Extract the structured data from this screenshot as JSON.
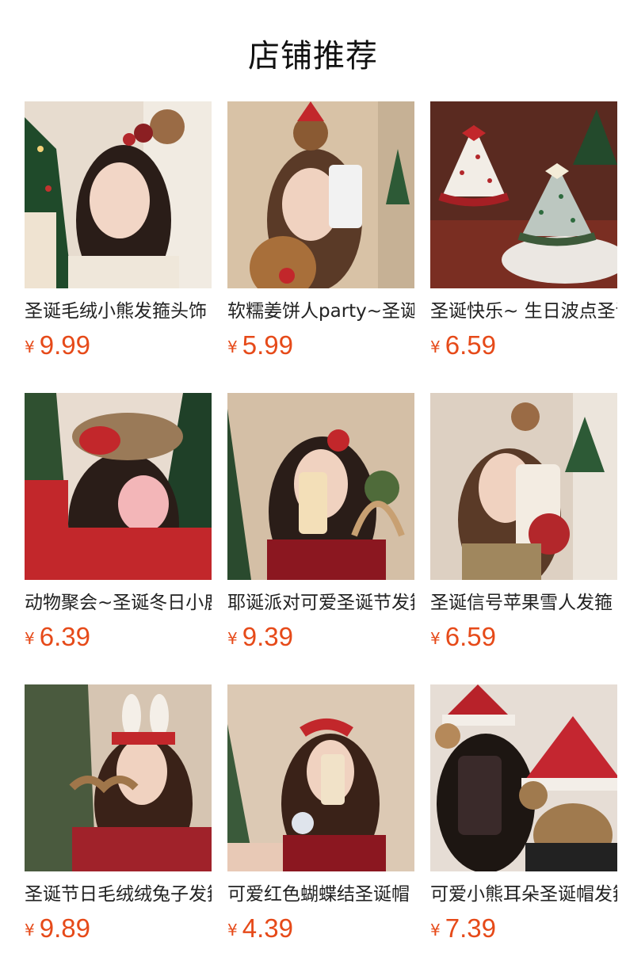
{
  "page": {
    "title": "店铺推荐"
  },
  "currency_symbol": "¥",
  "colors": {
    "price": "#e64a19",
    "title": "#111111",
    "name": "#222222"
  },
  "products": [
    {
      "name": "圣诞毛绒小熊发箍头饰",
      "price": "9.99",
      "image": "girl-wink-bear-headband-christmas-tree"
    },
    {
      "name": "软糯姜饼人party~圣诞",
      "price": "5.99",
      "image": "girl-selfie-gingerbread-bear-headband"
    },
    {
      "name": "圣诞快乐~ 生日波点圣诞帽",
      "price": "6.59",
      "image": "polka-dot-party-hats"
    },
    {
      "name": "动物聚会~圣诞冬日小鹿",
      "price": "6.39",
      "image": "girl-bunny-ears-red-bow"
    },
    {
      "name": "耶诞派对可爱圣诞节发箍",
      "price": "9.39",
      "image": "girl-red-sequin-dress-headband"
    },
    {
      "name": "圣诞信号苹果雪人发箍",
      "price": "6.59",
      "image": "girl-braids-bear-headband-selfie"
    },
    {
      "name": "圣诞节日毛绒绒兔子发箍",
      "price": "9.89",
      "image": "girl-white-bunny-ears-reindeer"
    },
    {
      "name": "可爱红色蝴蝶结圣诞帽",
      "price": "4.39",
      "image": "girl-mini-santa-hat-sequin"
    },
    {
      "name": "可爱小熊耳朵圣诞帽发箍",
      "price": "7.39",
      "image": "plaid-santa-hat-bear-ears"
    }
  ]
}
